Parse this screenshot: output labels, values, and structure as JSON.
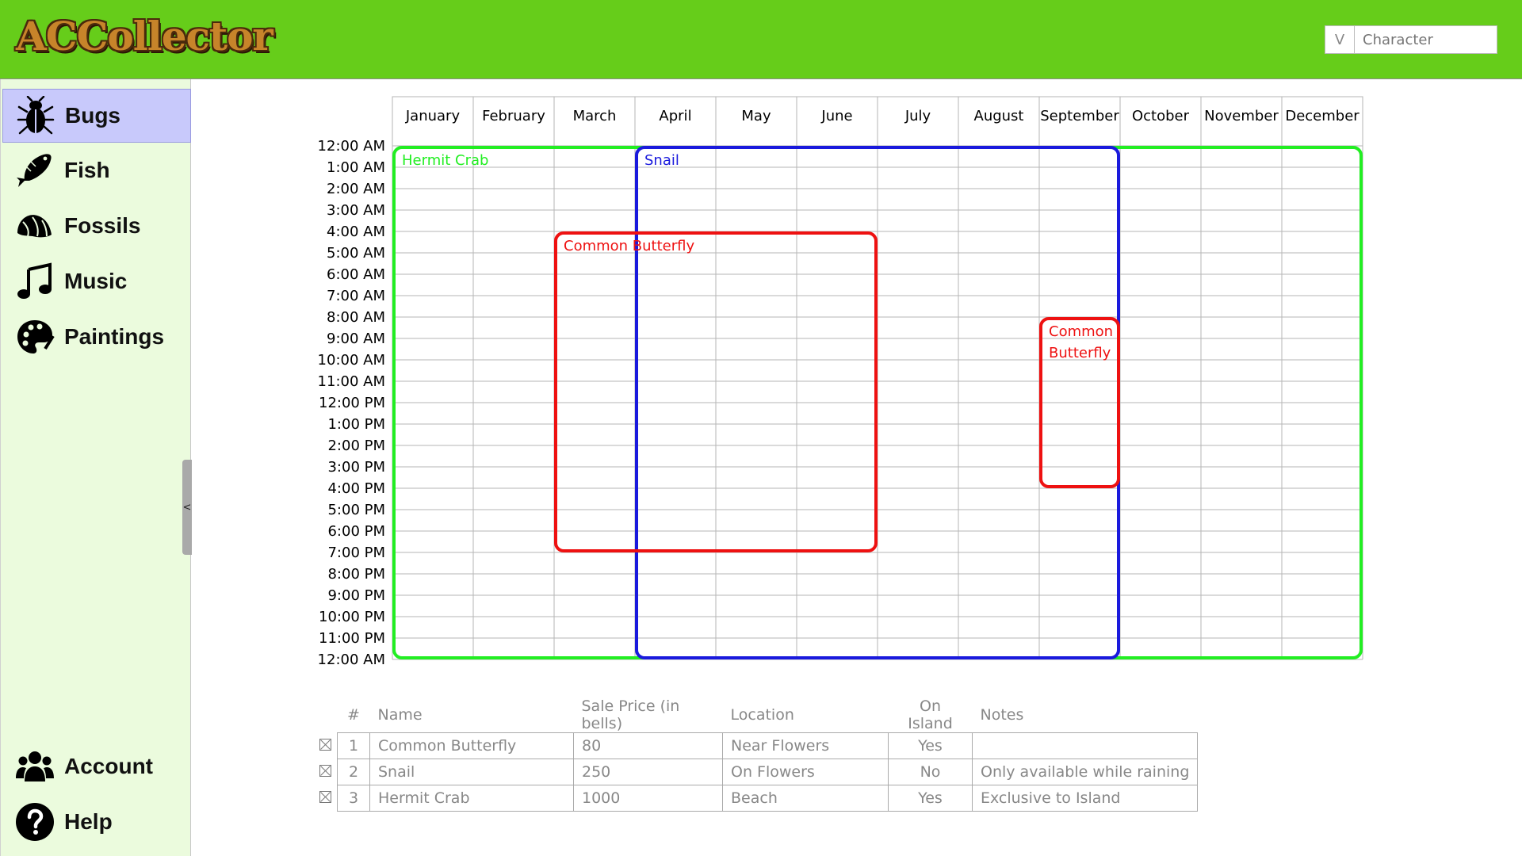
{
  "app": {
    "title": "ACCollector",
    "character_select": {
      "toggle_label": "V",
      "placeholder": "Character"
    }
  },
  "sidebar": {
    "items": [
      {
        "label": "Bugs",
        "icon": "bug-icon",
        "active": true
      },
      {
        "label": "Fish",
        "icon": "fish-icon",
        "active": false
      },
      {
        "label": "Fossils",
        "icon": "fossil-icon",
        "active": false
      },
      {
        "label": "Music",
        "icon": "music-note-icon",
        "active": false
      },
      {
        "label": "Paintings",
        "icon": "palette-icon",
        "active": false
      }
    ],
    "bottom_items": [
      {
        "label": "Account",
        "icon": "users-icon"
      },
      {
        "label": "Help",
        "icon": "help-icon"
      }
    ],
    "collapse_label": "<"
  },
  "calendar": {
    "months": [
      "January",
      "February",
      "March",
      "April",
      "May",
      "June",
      "July",
      "August",
      "September",
      "October",
      "November",
      "December"
    ],
    "times": [
      "12:00 AM",
      "1:00 AM",
      "2:00 AM",
      "3:00 AM",
      "4:00 AM",
      "5:00 AM",
      "6:00 AM",
      "7:00 AM",
      "8:00 AM",
      "9:00 AM",
      "10:00 AM",
      "11:00 AM",
      "12:00 PM",
      "1:00 PM",
      "2:00 PM",
      "3:00 PM",
      "4:00 PM",
      "5:00 PM",
      "6:00 PM",
      "7:00 PM",
      "8:00 PM",
      "9:00 PM",
      "10:00 PM",
      "11:00 PM",
      "12:00 AM"
    ],
    "ranges": [
      {
        "name": "Hermit Crab",
        "label_lines": [
          "Hermit Crab"
        ],
        "color": "#22ee22",
        "months": [
          "January",
          "December"
        ],
        "hours": [
          0,
          24
        ]
      },
      {
        "name": "Snail",
        "label_lines": [
          "Snail"
        ],
        "color": "#1a1add",
        "months": [
          "April",
          "September"
        ],
        "hours": [
          0,
          24
        ]
      },
      {
        "name": "Common Butterfly",
        "label_lines": [
          "Common Butterfly"
        ],
        "color": "#ee1111",
        "months": [
          "March",
          "June"
        ],
        "hours": [
          4,
          19
        ]
      },
      {
        "name": "Common Butterfly",
        "label_lines": [
          "Common",
          "Butterfly"
        ],
        "color": "#ee1111",
        "months": [
          "September",
          "September"
        ],
        "hours": [
          8,
          16
        ]
      }
    ]
  },
  "table": {
    "headers": [
      "#",
      "Name",
      "Sale Price (in bells)",
      "Location",
      "On Island",
      "Notes"
    ],
    "rows": [
      {
        "num": "1",
        "name": "Common Butterfly",
        "price": "80",
        "location": "Near Flowers",
        "on_island": "Yes",
        "notes": ""
      },
      {
        "num": "2",
        "name": "Snail",
        "price": "250",
        "location": "On Flowers",
        "on_island": "No",
        "notes": "Only available while raining"
      },
      {
        "num": "3",
        "name": "Hermit Crab",
        "price": "1000",
        "location": "Beach",
        "on_island": "Yes",
        "notes": "Exclusive to Island"
      }
    ]
  }
}
